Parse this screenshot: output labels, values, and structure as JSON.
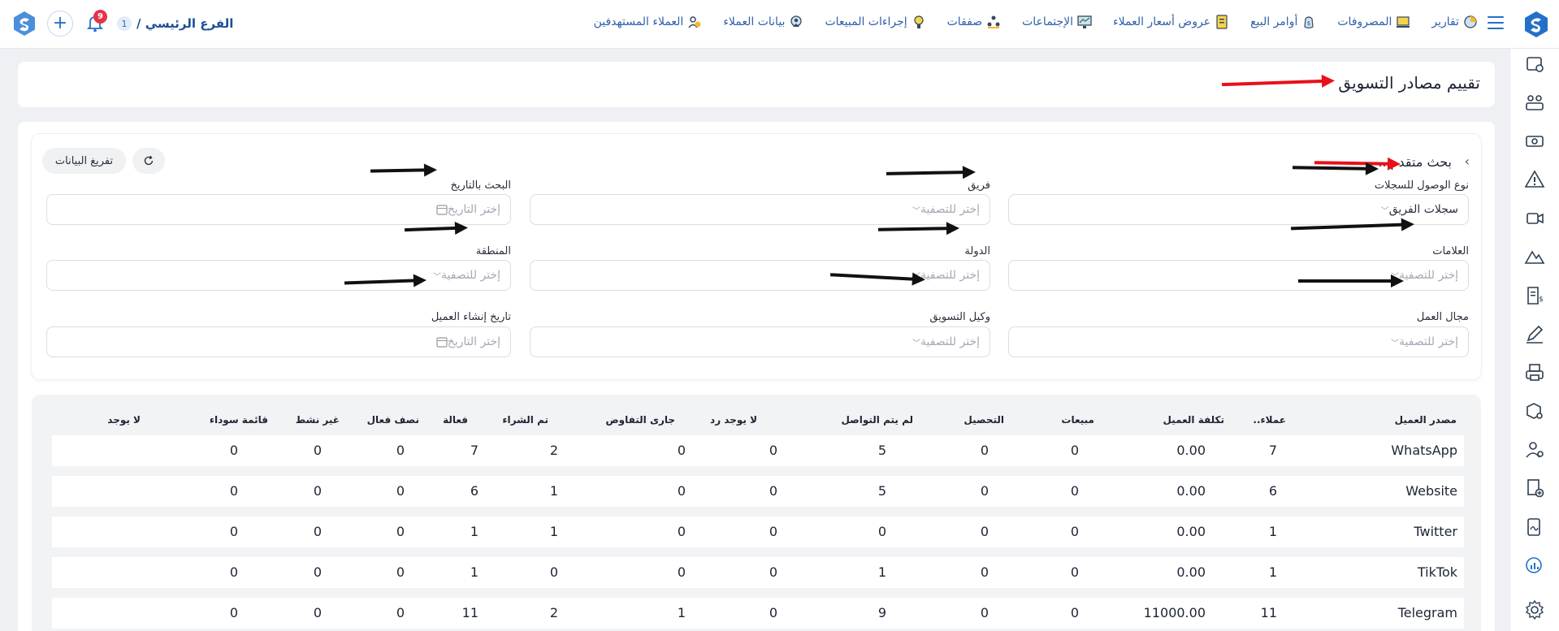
{
  "topbar": {
    "branch_label": "الفرع الرئيسي /",
    "branch_number": "1",
    "notification_count": "9",
    "nav": [
      {
        "label": "العملاء المستهدفين",
        "icon": "target-customers-icon"
      },
      {
        "label": "بيانات العملاء",
        "icon": "customer-data-icon"
      },
      {
        "label": "إجراءات المبيعات",
        "icon": "sales-actions-icon"
      },
      {
        "label": "صفقات",
        "icon": "deals-icon"
      },
      {
        "label": "الإجتماعات",
        "icon": "meetings-icon"
      },
      {
        "label": "عروض أسعار العملاء",
        "icon": "quotes-icon"
      },
      {
        "label": "أوامر البيع",
        "icon": "sales-orders-icon"
      },
      {
        "label": "المصروفات",
        "icon": "expenses-icon"
      },
      {
        "label": "تقارير",
        "icon": "reports-icon"
      }
    ]
  },
  "page": {
    "title": "تقييم مصادر التسويق"
  },
  "search": {
    "title": "بحث متقدم...",
    "clear_label": "تفريغ البيانات",
    "filters": [
      {
        "label": "نوع الوصول للسجلات",
        "value": "سجلات الفريق",
        "placeholder": "",
        "type": "select"
      },
      {
        "label": "فريق",
        "value": "",
        "placeholder": "إختر للتصفية",
        "type": "select"
      },
      {
        "label": "البحث بالتاريخ",
        "value": "",
        "placeholder": "إختر التاريخ",
        "type": "date"
      },
      {
        "label": "العلامات",
        "value": "",
        "placeholder": "إختر للتصفية",
        "type": "select"
      },
      {
        "label": "الدولة",
        "value": "",
        "placeholder": "إختر للتصفية",
        "type": "select"
      },
      {
        "label": "المنطقة",
        "value": "",
        "placeholder": "إختر للتصفية",
        "type": "select"
      },
      {
        "label": "مجال العمل",
        "value": "",
        "placeholder": "إختر للتصفية",
        "type": "select"
      },
      {
        "label": "وكيل التسويق",
        "value": "",
        "placeholder": "إختر للتصفية",
        "type": "select"
      },
      {
        "label": "تاريخ إنشاء العميل",
        "value": "",
        "placeholder": "إختر التاريخ",
        "type": "date"
      }
    ]
  },
  "table": {
    "headers": [
      "مصدر العميل",
      "عملاء..",
      "تكلفة العميل",
      "مبيعات",
      "التحصيل",
      "لم يتم التواصل",
      "لا يوجد رد",
      "جارى التفاوض",
      "تم الشراء",
      "فعالة",
      "نصف فعال",
      "غير نشط",
      "قائمة سوداء",
      "لا يوجد"
    ],
    "rows": [
      [
        "WhatsApp",
        "7",
        "0.00",
        "0",
        "0",
        "5",
        "0",
        "0",
        "2",
        "7",
        "0",
        "0",
        "0",
        ""
      ],
      [
        "Website",
        "6",
        "0.00",
        "0",
        "0",
        "5",
        "0",
        "0",
        "1",
        "6",
        "0",
        "0",
        "0",
        ""
      ],
      [
        "Twitter",
        "1",
        "0.00",
        "0",
        "0",
        "0",
        "0",
        "0",
        "1",
        "1",
        "0",
        "0",
        "0",
        ""
      ],
      [
        "TikTok",
        "1",
        "0.00",
        "0",
        "0",
        "1",
        "0",
        "0",
        "0",
        "1",
        "0",
        "0",
        "0",
        ""
      ],
      [
        "Telegram",
        "11",
        "11000.00",
        "0",
        "0",
        "9",
        "0",
        "1",
        "2",
        "11",
        "0",
        "0",
        "0",
        ""
      ]
    ]
  },
  "colors": {
    "accent": "#2470c9",
    "annotation_red": "#e8101a",
    "annotation_black": "#111111",
    "badge": "#e5334b"
  }
}
